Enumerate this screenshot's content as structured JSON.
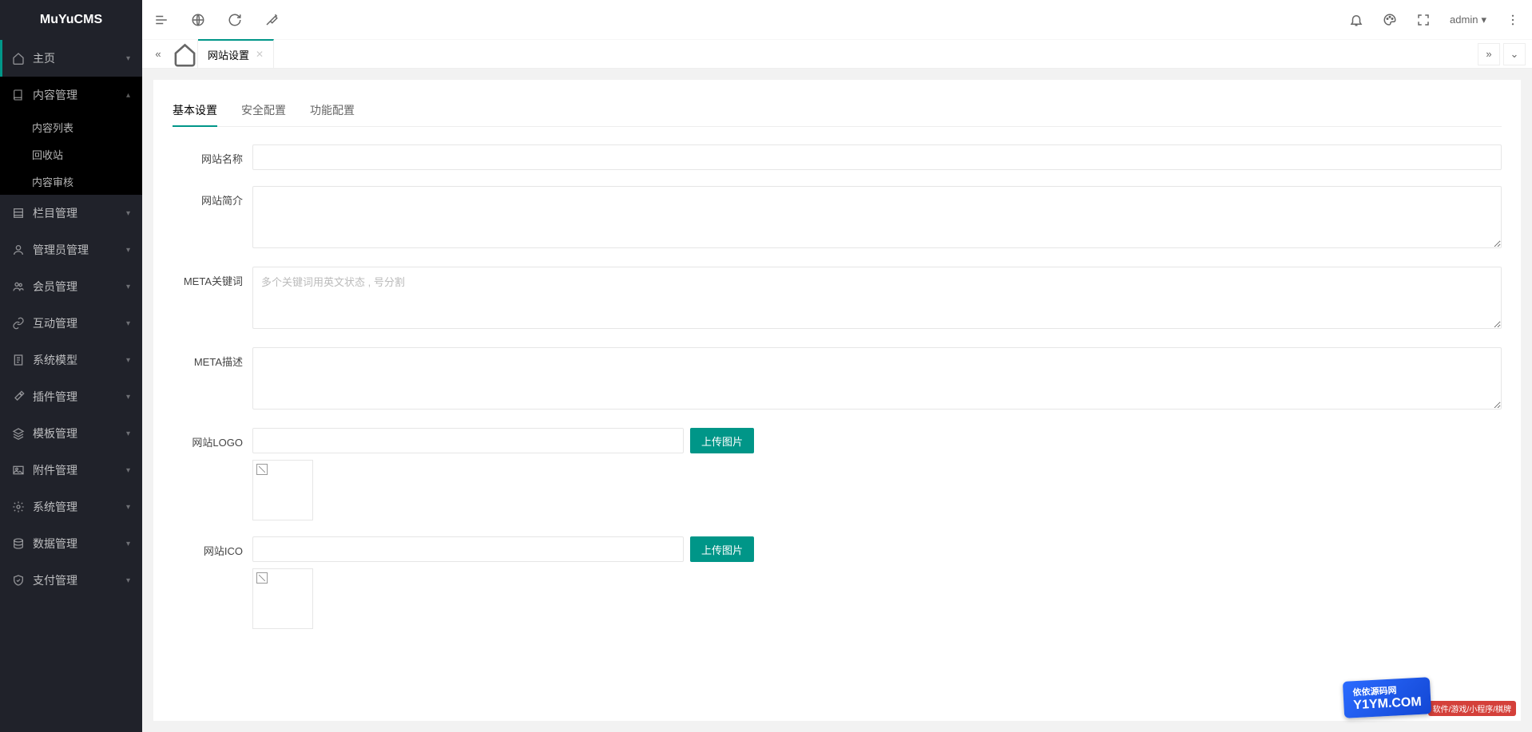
{
  "app": {
    "name": "MuYuCMS"
  },
  "topbar": {
    "user": "admin"
  },
  "sidebar": {
    "items": [
      {
        "label": "主页",
        "icon": "home"
      },
      {
        "label": "内容管理",
        "icon": "book",
        "expanded": true,
        "children": [
          {
            "label": "内容列表"
          },
          {
            "label": "回收站"
          },
          {
            "label": "内容审核"
          }
        ]
      },
      {
        "label": "栏目管理",
        "icon": "list"
      },
      {
        "label": "管理员管理",
        "icon": "user"
      },
      {
        "label": "会员管理",
        "icon": "users"
      },
      {
        "label": "互动管理",
        "icon": "link"
      },
      {
        "label": "系统模型",
        "icon": "doc"
      },
      {
        "label": "插件管理",
        "icon": "tools"
      },
      {
        "label": "模板管理",
        "icon": "layers"
      },
      {
        "label": "附件管理",
        "icon": "image"
      },
      {
        "label": "系统管理",
        "icon": "gear"
      },
      {
        "label": "数据管理",
        "icon": "db"
      },
      {
        "label": "支付管理",
        "icon": "shield"
      }
    ]
  },
  "tabs": {
    "active": "网站设置",
    "items": [
      {
        "label": "网站设置"
      }
    ]
  },
  "panel": {
    "tabs": [
      {
        "label": "基本设置",
        "active": true
      },
      {
        "label": "安全配置"
      },
      {
        "label": "功能配置"
      }
    ],
    "form": {
      "site_name_label": "网站名称",
      "site_name_value": "",
      "site_desc_label": "网站简介",
      "site_desc_value": "",
      "meta_kw_label": "META关键词",
      "meta_kw_placeholder": "多个关键词用英文状态 , 号分割",
      "meta_kw_value": "",
      "meta_desc_label": "META描述",
      "meta_desc_value": "",
      "site_logo_label": "网站LOGO",
      "site_logo_value": "",
      "site_ico_label": "网站ICO",
      "site_ico_value": "",
      "upload_btn": "上传图片"
    }
  },
  "watermark": {
    "main": "依依源码网",
    "domain": "Y1YM.COM",
    "sub": "软件/游戏/小程序/棋牌"
  }
}
